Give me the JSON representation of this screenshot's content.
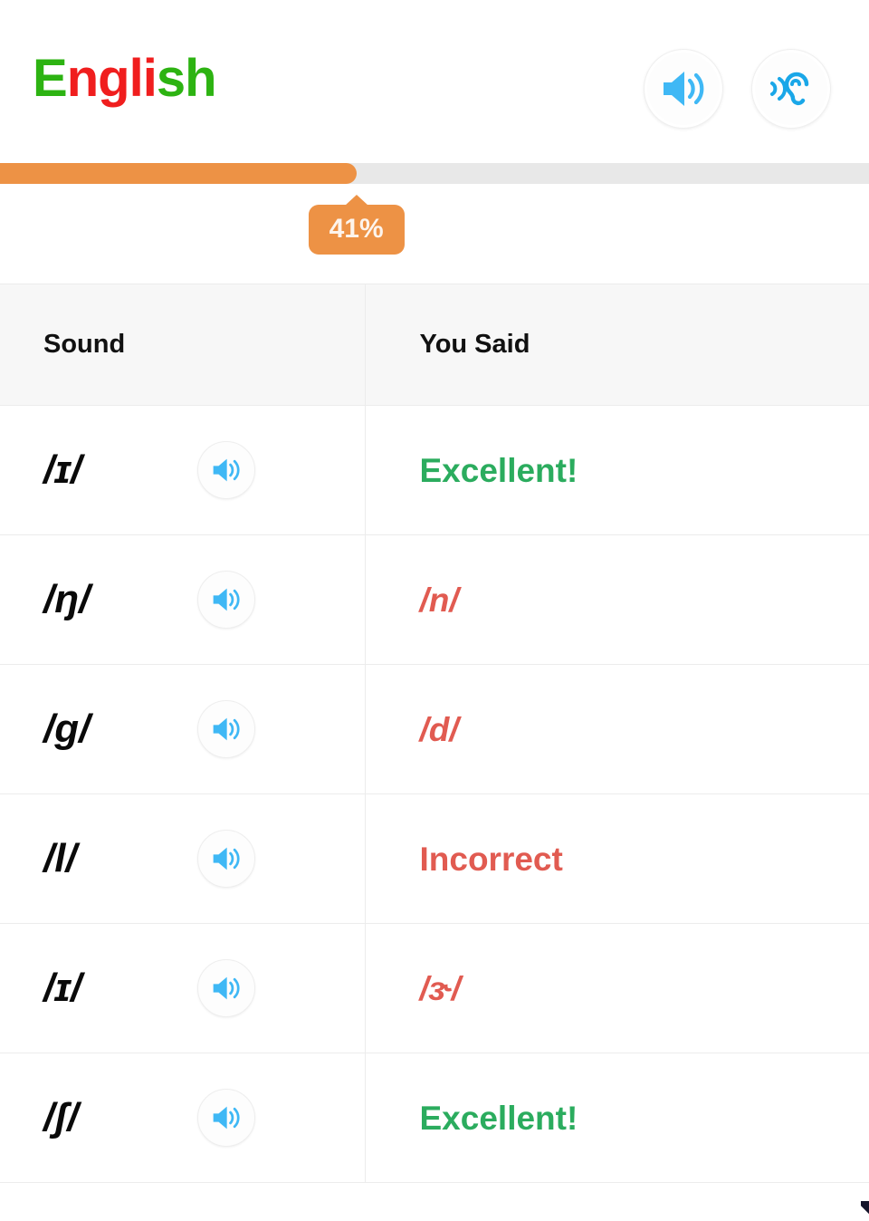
{
  "header": {
    "title_parts": [
      {
        "text": "E",
        "color": "#2DB312"
      },
      {
        "text": "n",
        "color": "#F01E1E"
      },
      {
        "text": "g",
        "color": "#F01E1E"
      },
      {
        "text": "l",
        "color": "#F01E1E"
      },
      {
        "text": "i",
        "color": "#F01E1E"
      },
      {
        "text": "s",
        "color": "#2DB312"
      },
      {
        "text": "h",
        "color": "#2DB312"
      }
    ],
    "title_text": "English",
    "actions": [
      {
        "name": "speaker-icon",
        "label": "Play audio"
      },
      {
        "name": "ear-listen-icon",
        "label": "Listen"
      }
    ]
  },
  "progress": {
    "percent": 41,
    "percent_label": "41%",
    "fill_color": "#ED9245",
    "track_color": "#e8e8e8"
  },
  "table": {
    "columns": [
      "Sound",
      "You Said"
    ],
    "rows": [
      {
        "sound": "/ɪ/",
        "said": "Excellent!",
        "status": "correct",
        "italic": false
      },
      {
        "sound": "/ŋ/",
        "said": "/n/",
        "status": "incorrect",
        "italic": true
      },
      {
        "sound": "/g/",
        "said": "/d/",
        "status": "incorrect",
        "italic": true
      },
      {
        "sound": "/l/",
        "said": "Incorrect",
        "status": "incorrect",
        "italic": false
      },
      {
        "sound": "/ɪ/",
        "said": "/ɝ/",
        "status": "incorrect",
        "italic": true
      },
      {
        "sound": "/ʃ/",
        "said": "Excellent!",
        "status": "correct",
        "italic": false
      }
    ]
  },
  "colors": {
    "correct": "#2BAC5E",
    "incorrect": "#E15B51",
    "icon_blue": "#3FB8F5",
    "header_bg": "#f7f7f7",
    "divider": "#ececec"
  }
}
